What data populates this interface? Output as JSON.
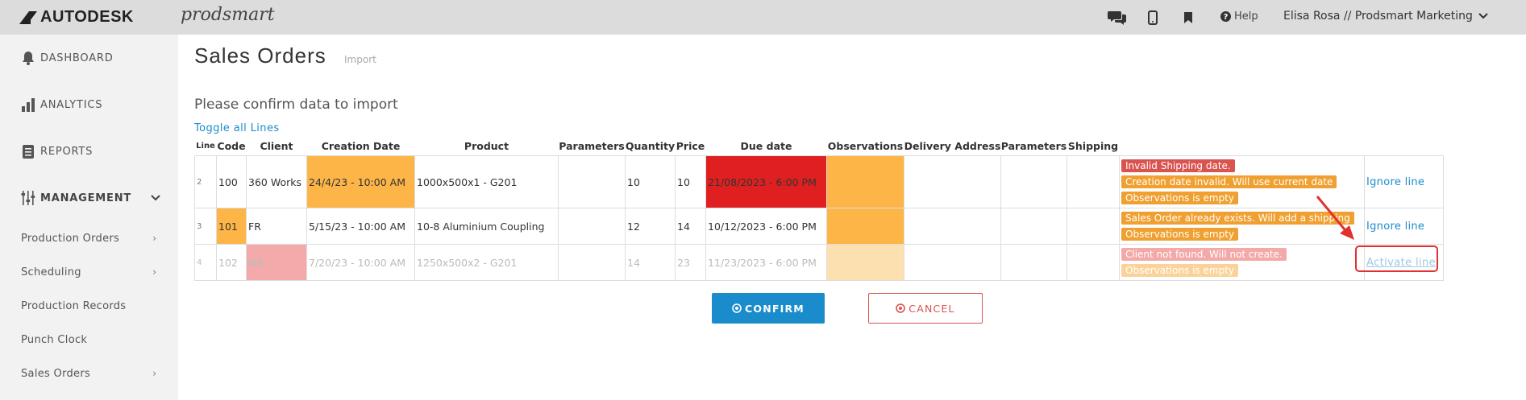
{
  "brand": {
    "autodesk": "AUTODESK",
    "prodsmart": "prodsmart"
  },
  "topbar": {
    "help_label": "Help",
    "user_label": "Elisa Rosa // Prodsmart Marketing",
    "icons": [
      "chat-icon",
      "mobile-icon",
      "bookmark-icon",
      "question-icon",
      "chevron-down-icon"
    ]
  },
  "sidebar": {
    "main": [
      {
        "label": "DASHBOARD",
        "icon": "bell-icon"
      },
      {
        "label": "ANALYTICS",
        "icon": "bar-chart-icon"
      },
      {
        "label": "REPORTS",
        "icon": "document-icon"
      },
      {
        "label": "MANAGEMENT",
        "icon": "sliders-icon"
      }
    ],
    "sub": [
      {
        "label": "Production Orders",
        "chevron": true
      },
      {
        "label": "Scheduling",
        "chevron": true
      },
      {
        "label": "Production Records",
        "chevron": false
      },
      {
        "label": "Punch Clock",
        "chevron": false
      },
      {
        "label": "Sales Orders",
        "chevron": true
      }
    ]
  },
  "page": {
    "title": "Sales Orders",
    "subtitle": "Import",
    "confirm_title": "Please confirm data to import",
    "toggle_label": "Toggle all Lines"
  },
  "table": {
    "headers": [
      "Line",
      "Code",
      "Client",
      "Creation Date",
      "Product",
      "Parameters",
      "Quantity",
      "Price",
      "Due date",
      "Observations",
      "Delivery Address",
      "Parameters",
      "Shipping"
    ],
    "rows": [
      {
        "line": "2",
        "code": "100",
        "client": "360 Works",
        "creation_date": "24/4/23 - 10:00 AM",
        "product": "1000x500x1 - G201",
        "parameters": "",
        "quantity": "10",
        "price": "10",
        "due_date": "21/08/2023 - 6:00 PM",
        "observations": "",
        "delivery_address": "",
        "parameters2": "",
        "shipping": "",
        "messages": [
          {
            "text": "Invalid Shipping date.",
            "level": "error"
          },
          {
            "text": "Creation date invalid. Will use current date",
            "level": "warning"
          },
          {
            "text": "Observations is empty",
            "level": "warning"
          }
        ],
        "action": "Ignore line"
      },
      {
        "line": "3",
        "code": "101",
        "client": "FR",
        "creation_date": "5/15/23 - 10:00 AM",
        "product": "10-8 Aluminium Coupling",
        "parameters": "",
        "quantity": "12",
        "price": "14",
        "due_date": "10/12/2023 - 6:00 PM",
        "observations": "",
        "delivery_address": "",
        "parameters2": "",
        "shipping": "",
        "messages": [
          {
            "text": "Sales Order already exists. Will add a shipping",
            "level": "warning"
          },
          {
            "text": "Observations is empty",
            "level": "warning"
          }
        ],
        "action": "Ignore line"
      },
      {
        "line": "4",
        "code": "102",
        "client": "MR",
        "creation_date": "7/20/23 - 10:00 AM",
        "product": "1250x500x2 - G201",
        "parameters": "",
        "quantity": "14",
        "price": "23",
        "due_date": "11/23/2023 - 6:00 PM",
        "observations": "",
        "delivery_address": "",
        "parameters2": "",
        "shipping": "",
        "messages": [
          {
            "text": "Client not found. Will not create.",
            "level": "error"
          },
          {
            "text": "Observations is empty",
            "level": "warning"
          }
        ],
        "action": "Activate line"
      }
    ]
  },
  "buttons": {
    "confirm": "CONFIRM",
    "cancel": "CANCEL"
  },
  "colors": {
    "accent": "#1a8ccc",
    "warning": "#f0a030",
    "error": "#d9534f",
    "error_cell": "#e02020",
    "highlight_cell": "#fdb548"
  }
}
